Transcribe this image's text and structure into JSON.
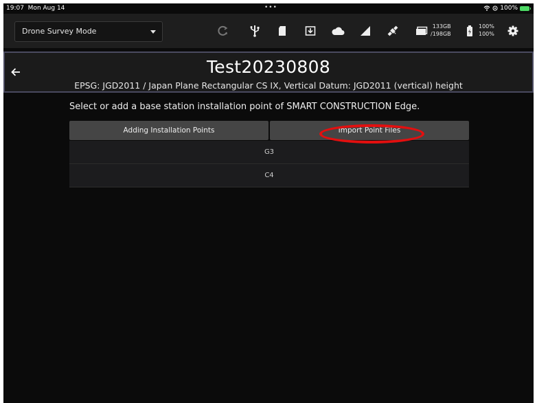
{
  "status_bar": {
    "time": "19:07",
    "date": "Mon Aug 14",
    "battery": "100%",
    "dots": "•••"
  },
  "toolbar": {
    "mode": "Drone Survey Mode",
    "storage_used": "133GB",
    "storage_total": "/198GB",
    "battery_1": "100%",
    "battery_2": "100%",
    "icons": [
      "gps-status-icon",
      "usb-icon",
      "sd-card-icon",
      "download-icon",
      "cloud-icon",
      "signal-icon",
      "satellite-icon",
      "folder-icon",
      "battery-icon",
      "gear-icon"
    ]
  },
  "header": {
    "title": "Test20230808",
    "subtitle": "EPSG: JGD2011 / Japan Plane Rectangular CS IX, Vertical Datum: JGD2011 (vertical) height"
  },
  "instruction": "Select or add a base station installation point of SMART CONSTRUCTION Edge.",
  "buttons": {
    "add": "Adding Installation Points",
    "import": "Import Point Files"
  },
  "points": [
    "G3",
    "C4"
  ],
  "colors": {
    "background": "#0b0b0b",
    "toolbar": "#1e1e1e",
    "button": "#454545",
    "annotation": "#e30f0f"
  }
}
